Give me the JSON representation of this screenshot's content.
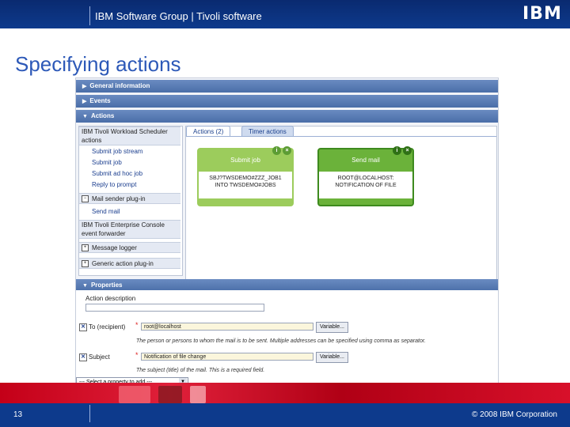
{
  "header": {
    "title": "IBM Software Group | Tivoli software",
    "logo_text": "IBM"
  },
  "slide_title": "Specifying actions",
  "sections": {
    "general": "General information",
    "events": "Events",
    "actions": "Actions",
    "properties": "Properties"
  },
  "tree": {
    "group1": "IBM Tivoli Workload Scheduler actions",
    "group1_items": [
      "Submit job stream",
      "Submit job",
      "Submit ad hoc job",
      "Reply to prompt"
    ],
    "group2": "Mail sender plug-in",
    "group2_items": [
      "Send mail"
    ],
    "group3": "IBM Tivoli Enterprise Console event forwarder",
    "group4": "Message logger",
    "group5": "Generic action plug-in"
  },
  "tabs": {
    "actions": "Actions (2)",
    "timers": "Timer actions"
  },
  "cards": [
    {
      "title": "Submit job",
      "body_line1": "SBJ?TWSDEMO#ZZZ_JOB1",
      "body_line2": "INTO TWSDEMO#JOBS",
      "color": "#9ccc5c"
    },
    {
      "title": "Send mail",
      "body_line1": "ROOT@LOCALHOST:",
      "body_line2": "NOTIFICATION OF FILE",
      "color": "#6bb23a"
    }
  ],
  "properties": {
    "action_description_label": "Action description",
    "to_label": "To (recipient)",
    "to_value": "root@localhost",
    "variable_btn": "Variable...",
    "to_hint": "The person or persons to whom the mail is to be sent. Multiple addresses can be specified using comma as separator.",
    "subject_label": "Subject",
    "subject_value": "Notification of file change",
    "subject_hint": "The subject (title) of the mail. This is a required field.",
    "select_placeholder": "--- Select a property to add ---"
  },
  "footer": {
    "page_number": "13",
    "copyright": "© 2008 IBM Corporation"
  },
  "colors": {
    "header": "#0d3a8c",
    "title": "#2d59b8",
    "strip": "#c40018"
  }
}
